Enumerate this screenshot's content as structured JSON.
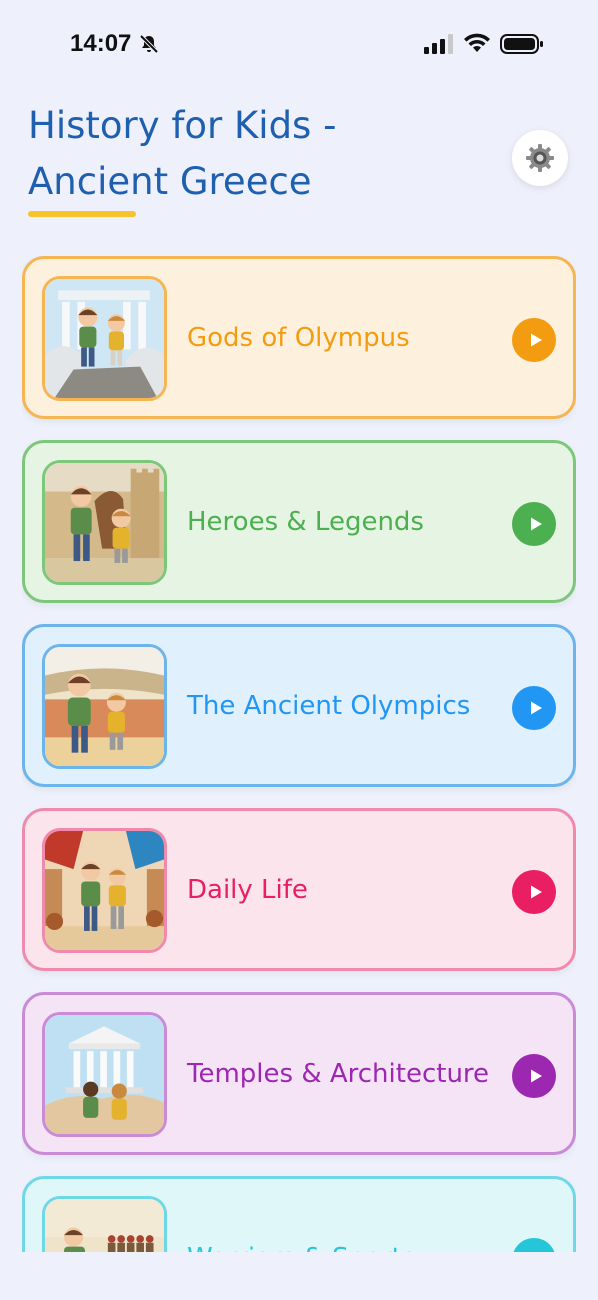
{
  "status": {
    "time": "14:07"
  },
  "header": {
    "title_line1": "History for Kids -",
    "title_line2": "Ancient Greece"
  },
  "topics": [
    {
      "label": "Gods of Olympus",
      "accent": "#f39c12",
      "bg": "#fdf1dd",
      "border": "#f5b553",
      "scene": "temple-rock"
    },
    {
      "label": "Heroes & Legends",
      "accent": "#4caf50",
      "bg": "#e6f4e4",
      "border": "#7cc77a",
      "scene": "trojan-horse"
    },
    {
      "label": "The Ancient Olympics",
      "accent": "#2196f3",
      "bg": "#e1f0fd",
      "border": "#6cb4ea",
      "scene": "stadium"
    },
    {
      "label": "Daily Life",
      "accent": "#e91e63",
      "bg": "#fce4ec",
      "border": "#f08aad",
      "scene": "market"
    },
    {
      "label": "Temples & Architecture",
      "accent": "#9c27b0",
      "bg": "#f4e4f6",
      "border": "#c98ad6",
      "scene": "parthenon"
    },
    {
      "label": "Warriors & Sports",
      "accent": "#26c6da",
      "bg": "#e0f7fa",
      "border": "#6fd8e6",
      "scene": "warriors"
    }
  ]
}
